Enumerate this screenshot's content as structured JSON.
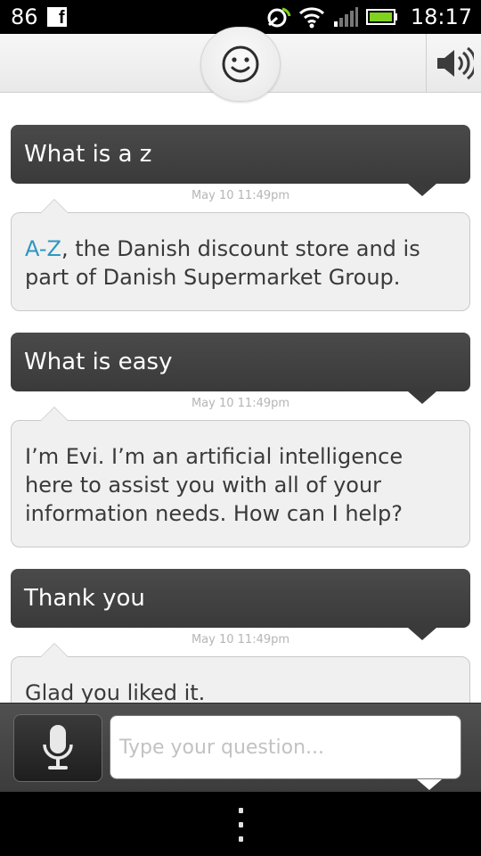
{
  "status_bar": {
    "notification_count": "86",
    "facebook_icon_letter": "f",
    "time": "18:17",
    "icons": [
      "sync-icon",
      "wifi-icon",
      "signal-icon",
      "battery-icon"
    ]
  },
  "header": {
    "evi_icon": "smiley-icon",
    "speaker_icon": "speaker-icon"
  },
  "conversation": [
    {
      "question": "What is a z",
      "timestamp": "May 10 11:49pm",
      "answer_link": "A-Z",
      "answer": ", the Danish discount store and is part of Danish Supermarket Group."
    },
    {
      "question": "What is easy",
      "timestamp": "May 10 11:49pm",
      "answer_link": "",
      "answer": "I’m Evi. I’m an artificial intelligence here to assist you with all of your information needs. How can I help?"
    },
    {
      "question": "Thank you",
      "timestamp": "May 10 11:49pm",
      "answer_link": "",
      "answer": "Glad you liked it."
    }
  ],
  "input": {
    "placeholder": "Type your question...",
    "value": "",
    "mic_icon": "microphone-icon"
  },
  "nav": {
    "menu_icon": "menu-dots-icon"
  }
}
